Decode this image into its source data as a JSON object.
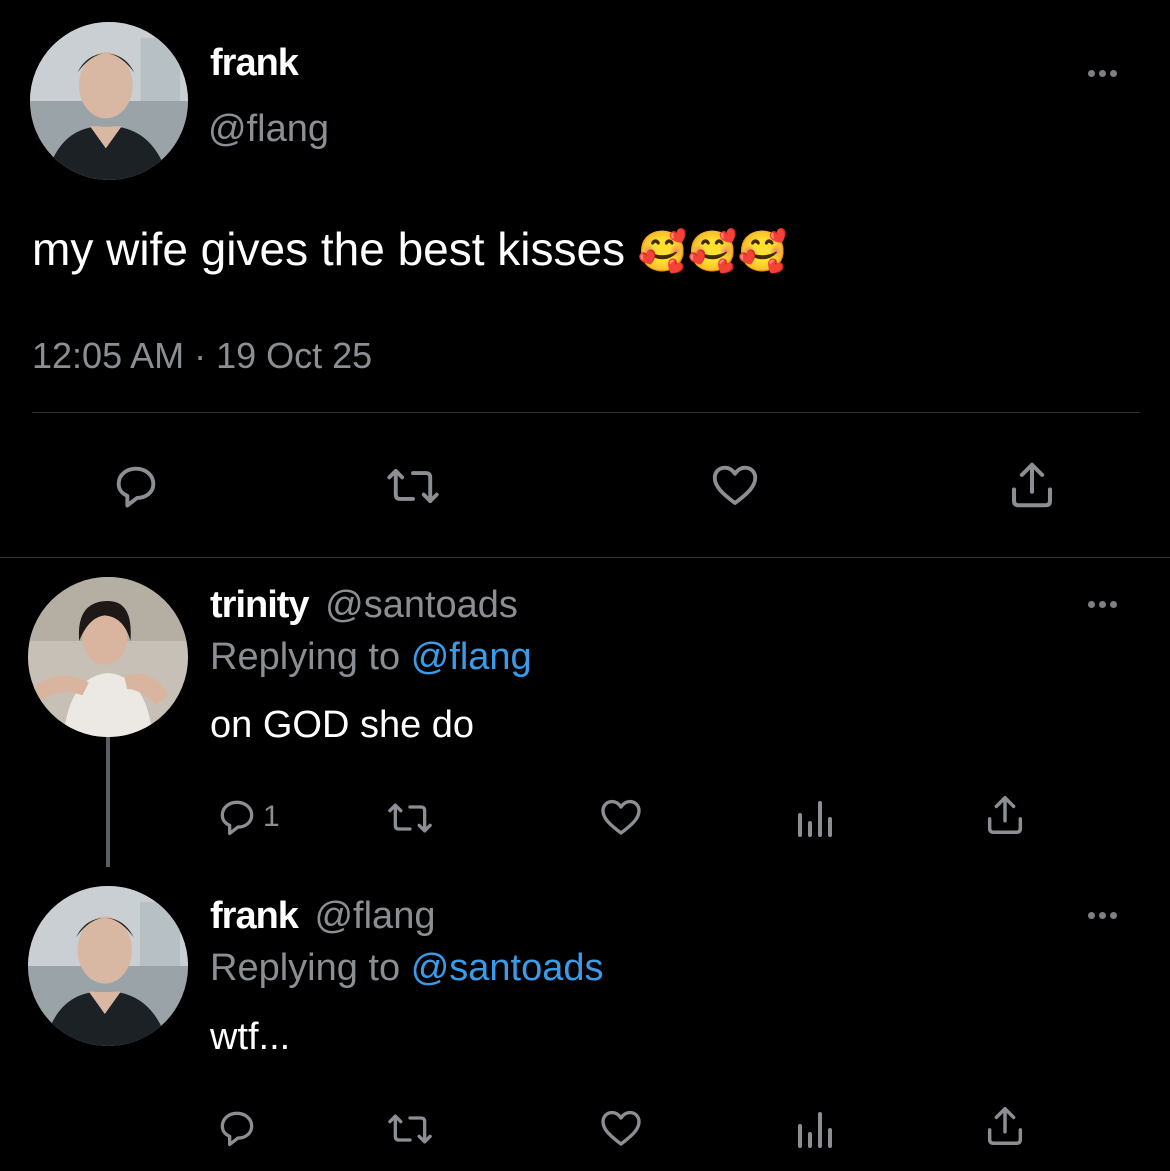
{
  "main_tweet": {
    "display_name": "frank",
    "handle": "@flang",
    "text": "my wife gives the best kisses",
    "emoji": "🥰🥰🥰",
    "timestamp": "12:05 AM · 19 Oct 25"
  },
  "reply1": {
    "display_name": "trinity",
    "handle": "@santoads",
    "replying_prefix": "Replying to",
    "replying_to": "@flang",
    "text": "on GOD she do",
    "reply_count": "1"
  },
  "reply2": {
    "display_name": "frank",
    "handle": "@flang",
    "replying_prefix": "Replying to",
    "replying_to": "@santoads",
    "text": "wtf..."
  },
  "colors": {
    "background": "#000000",
    "text": "#e7e9ea",
    "muted": "#8b8f93",
    "link": "#3a9be8",
    "icon": "#8b8f93"
  },
  "icons": [
    "reply-icon",
    "retweet-icon",
    "like-icon",
    "analytics-icon",
    "share-icon",
    "more-icon"
  ]
}
